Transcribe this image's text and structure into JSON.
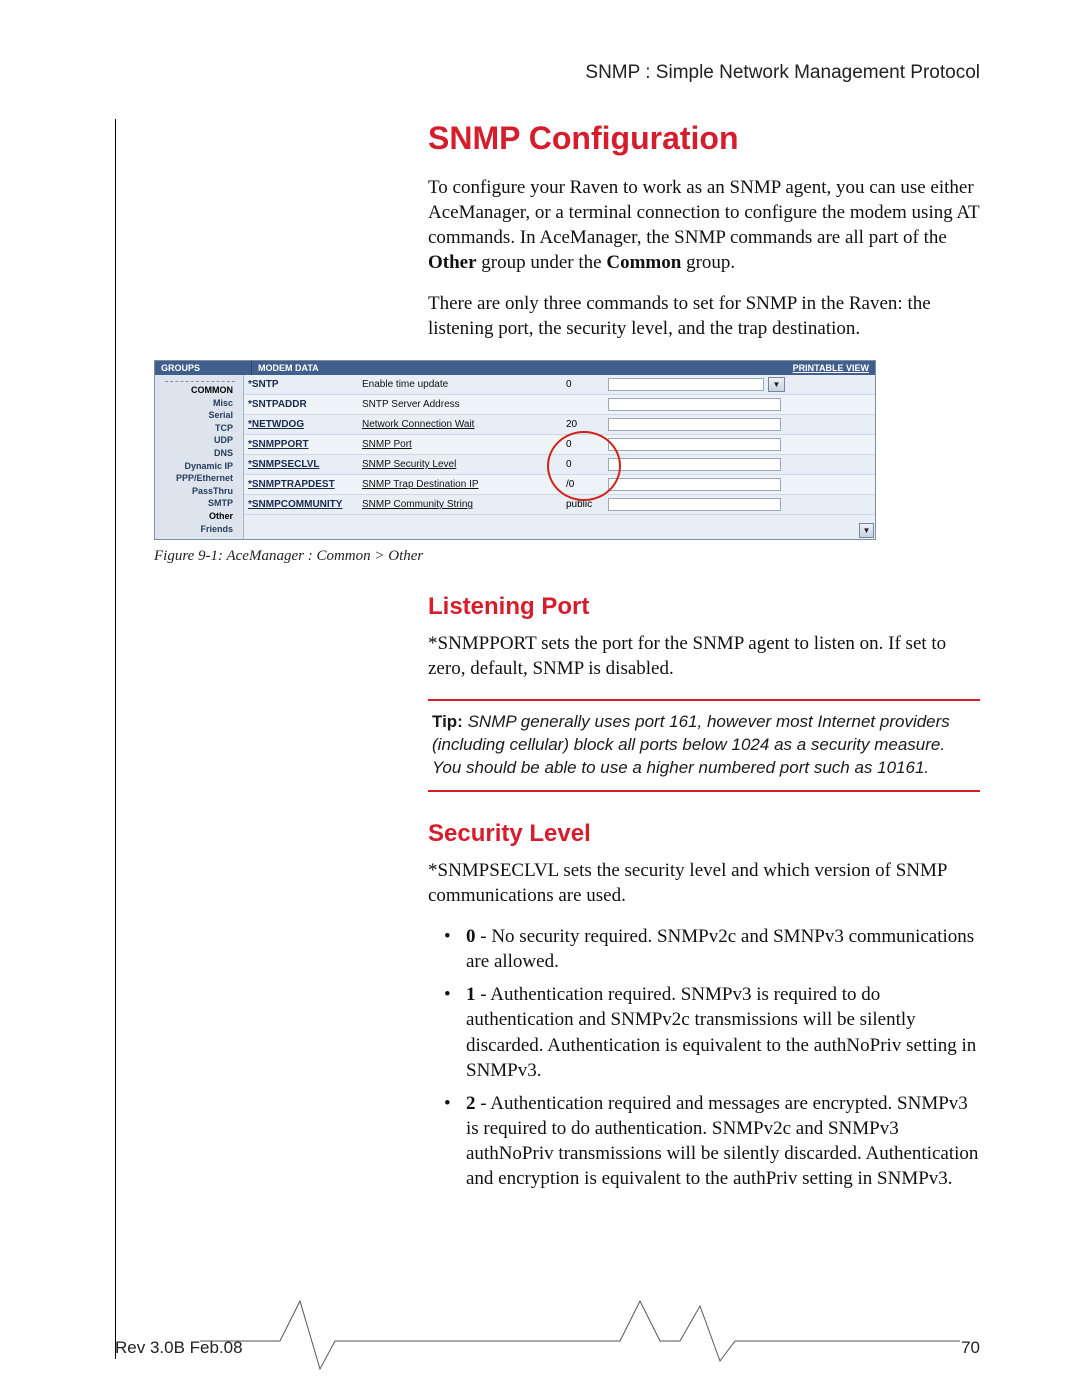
{
  "header": {
    "breadcrumb": "SNMP : Simple Network Management Protocol"
  },
  "title": "SNMP Configuration",
  "intro1_a": "To configure your Raven to work as an SNMP agent, you can use either AceManager, or a terminal connection to configure the modem using AT commands. In AceManager, the SNMP commands are all part of the ",
  "intro1_b": "Other",
  "intro1_c": " group under the ",
  "intro1_d": "Common",
  "intro1_e": " group.",
  "intro2": "There are only three commands to set for SNMP in the Raven: the listening port, the security level, and the trap destination.",
  "ace": {
    "header": {
      "groups": "GROUPS",
      "modemdata": "MODEM DATA",
      "printable": "PRINTABLE VIEW"
    },
    "side": [
      "COMMON",
      "Misc",
      "Serial",
      "TCP",
      "UDP",
      "DNS",
      "Dynamic IP",
      "PPP/Ethernet",
      "PassThru",
      "SMTP",
      "Other",
      "Friends"
    ],
    "rows": [
      {
        "name": "*SNTP",
        "desc": "Enable time update",
        "val": "0",
        "dropdown": true,
        "nameLinked": false,
        "descLinked": false
      },
      {
        "name": "*SNTPADDR",
        "desc": "SNTP Server Address",
        "val": "",
        "dropdown": false,
        "nameLinked": false,
        "descLinked": false
      },
      {
        "name": "*NETWDOG",
        "desc": "Network Connection Wait",
        "val": "20",
        "dropdown": false,
        "nameLinked": true,
        "descLinked": true
      },
      {
        "name": "*SNMPPORT",
        "desc": "SNMP Port",
        "val": "0",
        "dropdown": false,
        "nameLinked": true,
        "descLinked": true
      },
      {
        "name": "*SNMPSECLVL",
        "desc": "SNMP Security Level",
        "val": "0",
        "dropdown": false,
        "nameLinked": true,
        "descLinked": true
      },
      {
        "name": "*SNMPTRAPDEST",
        "desc": "SNMP Trap Destination IP",
        "val": "/0",
        "dropdown": false,
        "nameLinked": true,
        "descLinked": true
      },
      {
        "name": "*SNMPCOMMUNITY",
        "desc": "SNMP Community String",
        "val": "public",
        "dropdown": false,
        "nameLinked": true,
        "descLinked": true
      }
    ]
  },
  "figcaption": "Figure 9-1: AceManager : Common > Other",
  "listening": {
    "heading": "Listening Port",
    "para": "*SNMPPORT sets the port for the SNMP agent to listen on. If set to zero, default, SNMP is disabled."
  },
  "tip": {
    "label": "Tip:",
    "text": " SNMP generally uses port 161, however most Internet providers (including cellular) block all ports below 1024 as a security measure. You should be able to use a higher numbered port such as 10161."
  },
  "security": {
    "heading": "Security Level",
    "intro": "*SNMPSECLVL sets the security level and which version of SNMP communications are used.",
    "items": [
      {
        "lvl": "0",
        "text": " - No security required. SNMPv2c and SMNPv3 communications are allowed."
      },
      {
        "lvl": "1",
        "text": " - Authentication required. SNMPv3 is required to do authentication and SNMPv2c transmissions will be silently discarded. Authentication is equivalent to the authNoPriv setting in SNMPv3."
      },
      {
        "lvl": "2",
        "text": " - Authentication required and messages are encrypted. SNMPv3 is required to do authentication. SNMPv2c and SNMPv3 authNoPriv transmissions will be silently discarded. Authentication and encryption is equivalent to the authPriv setting in SNMPv3."
      }
    ]
  },
  "footer": {
    "rev": "Rev 3.0B  Feb.08",
    "page": "70"
  }
}
